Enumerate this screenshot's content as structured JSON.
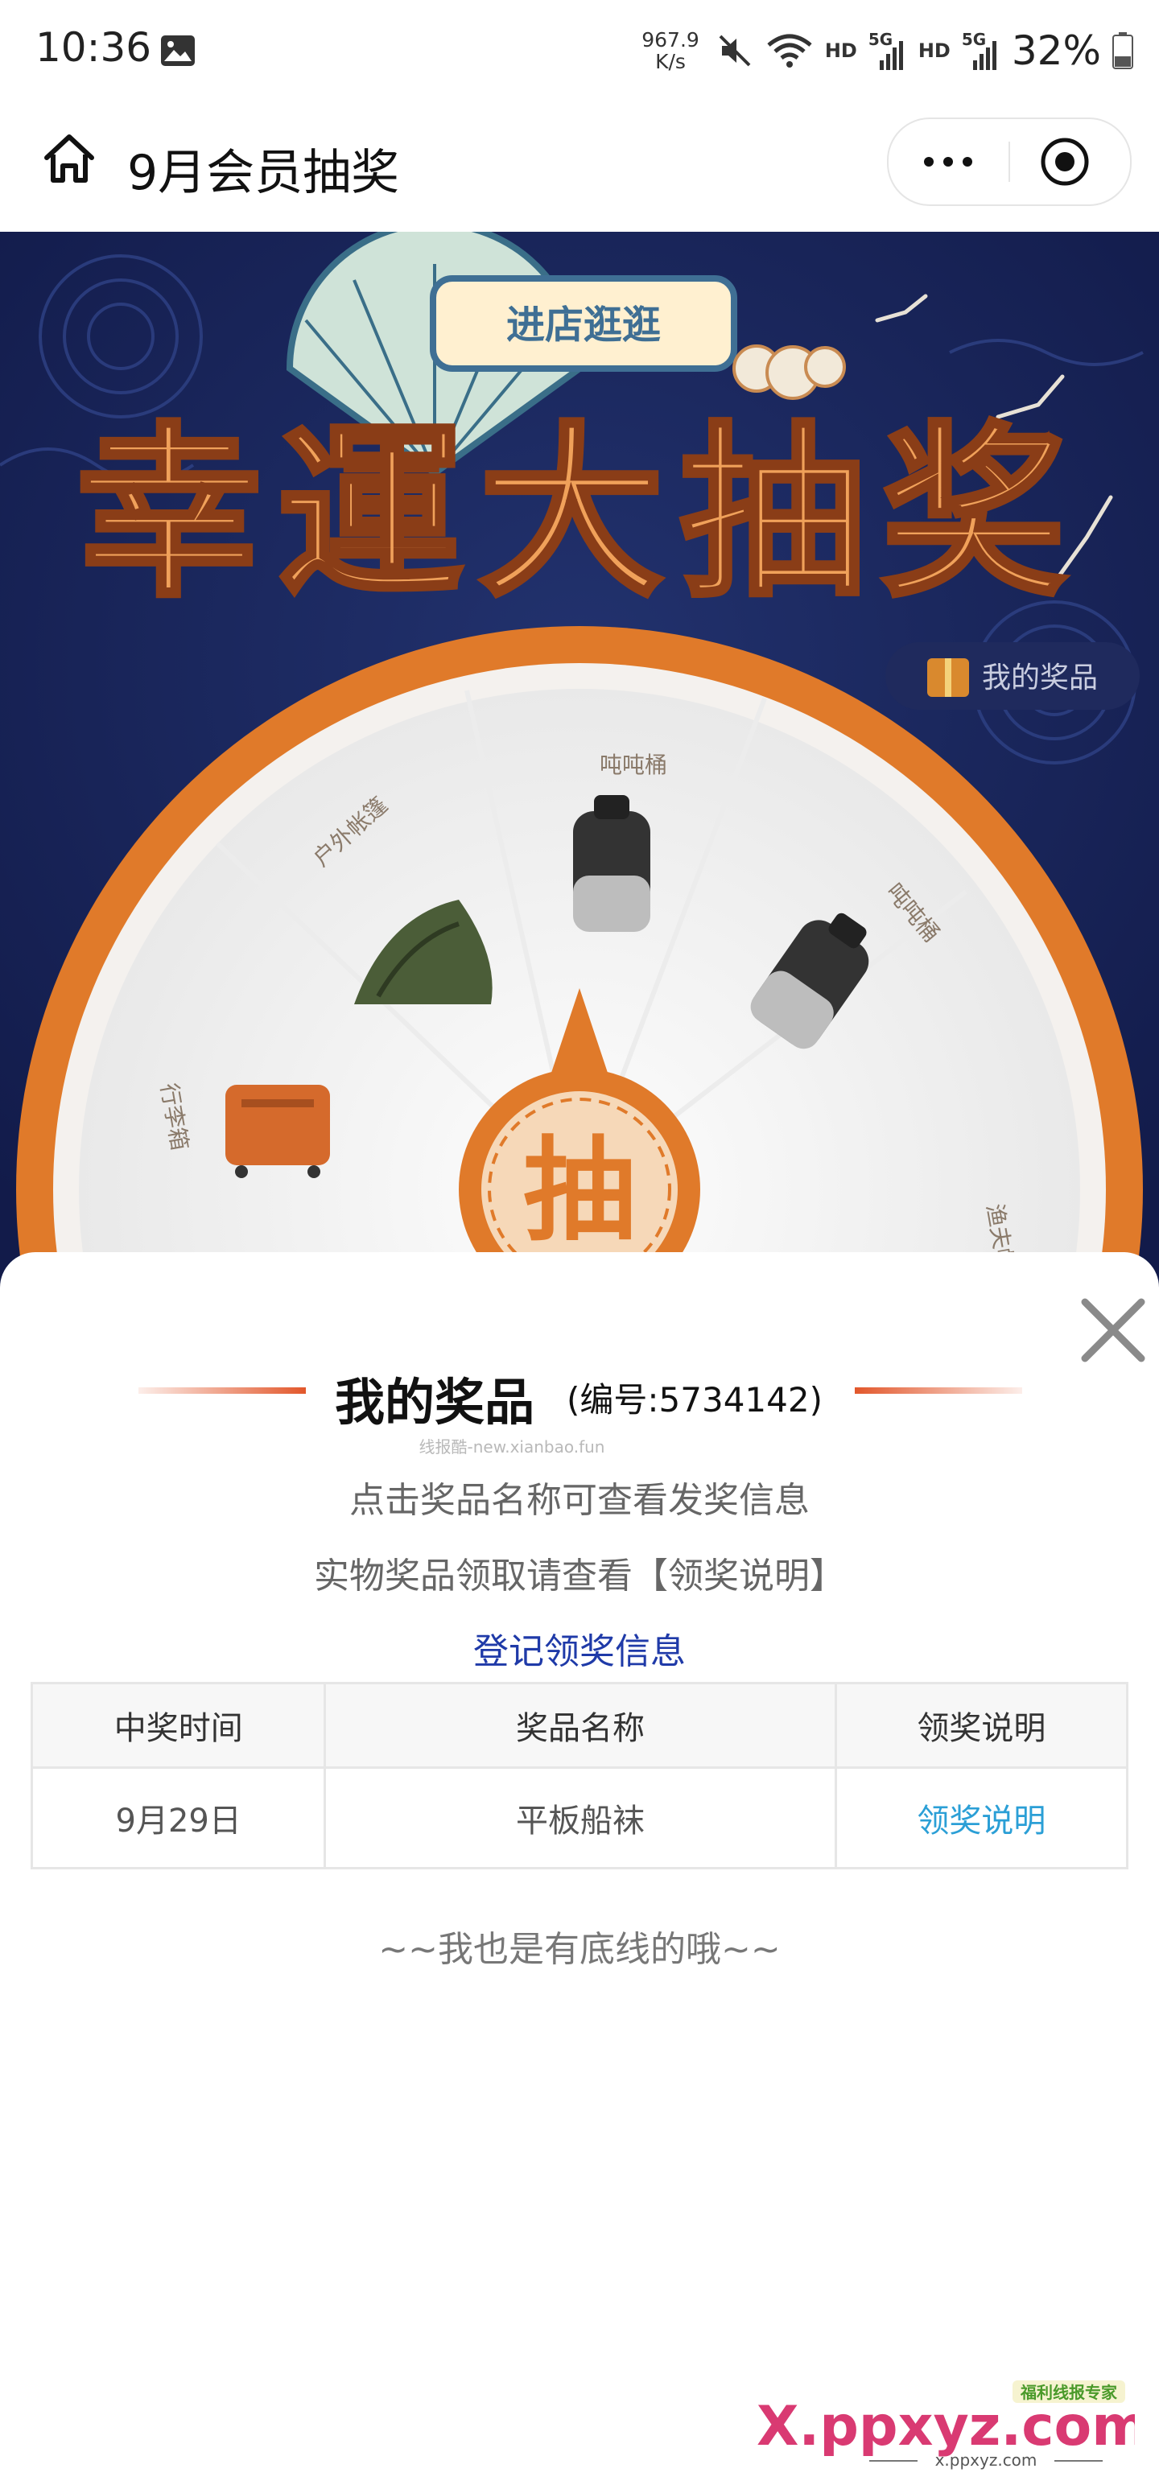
{
  "status_bar": {
    "time": "10:36",
    "net_speed_value": "967.9",
    "net_speed_unit": "K/s",
    "hd_label_1": "HD",
    "hd_label_2": "HD",
    "network_1": "5G",
    "network_2": "5G",
    "battery": "32%",
    "icons": [
      "photo-icon",
      "mute-icon",
      "wifi-icon",
      "signal-icon",
      "battery-icon"
    ]
  },
  "nav": {
    "title": "9月会员抽奖",
    "icons": [
      "home-icon",
      "more-icon",
      "target-icon"
    ]
  },
  "banner": {
    "shop_button": "进店逛逛",
    "headline": "幸運大抽奖",
    "my_prizes_button": "我的奖品",
    "draw_button": "抽",
    "wheel_items": [
      "户外帐篷",
      "吨吨桶",
      "吨吨桶",
      "行李箱",
      "渔夫帽"
    ],
    "colors": {
      "background": "#182560",
      "wheel_ring": "#e07a2a",
      "headline": "#f0a15a"
    }
  },
  "modal": {
    "title": "我的奖品",
    "serial": "(编号:5734142)",
    "watermark": "线报酷-new.xianbao.fun",
    "hint_1": "点击奖品名称可查看发奖信息",
    "hint_2": "实物奖品领取请查看【领奖说明】",
    "register_link": "登记领奖信息",
    "table": {
      "headers": [
        "中奖时间",
        "奖品名称",
        "领奖说明"
      ],
      "rows": [
        {
          "time": "9月29日",
          "name": "平板船袜",
          "desc": "领奖说明"
        }
      ]
    },
    "footer_text": "~~我也是有底线的哦~~",
    "colors": {
      "link": "#1f3aa8",
      "claim_link": "#2b9fd6",
      "accent_line": "#e2572b"
    }
  },
  "corner_watermark": {
    "brand": "X.ppxyz.com",
    "tagline": "福利线报专家",
    "url": "x.ppxyz.com"
  }
}
